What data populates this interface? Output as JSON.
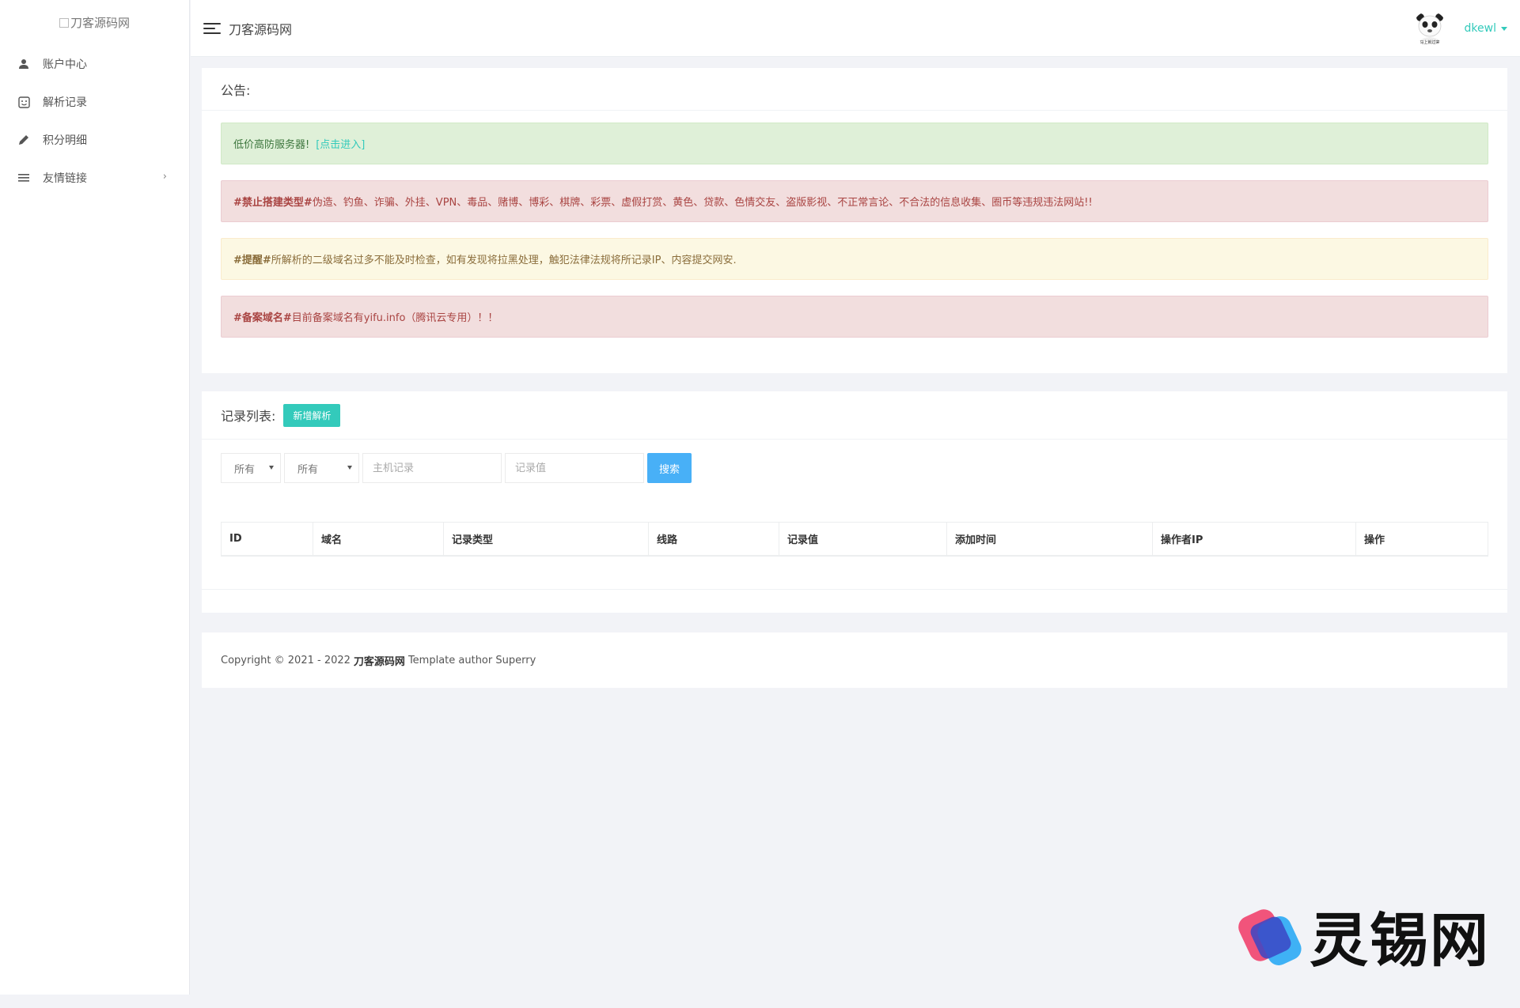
{
  "sidebar": {
    "logo_alt": "刀客源码网",
    "items": [
      {
        "label": "账户中心",
        "icon": "user-icon"
      },
      {
        "label": "解析记录",
        "icon": "sticker-icon"
      },
      {
        "label": "积分明细",
        "icon": "pencil-icon"
      },
      {
        "label": "友情链接",
        "icon": "list-icon",
        "chevron": "›"
      }
    ]
  },
  "header": {
    "site_title": "刀客源码网",
    "username": "dkewl",
    "avatar_caption": "马上就过来"
  },
  "notice": {
    "title": "公告:",
    "alerts": [
      {
        "type": "success",
        "text": "低价高防服务器!",
        "link": "[点击进入]"
      },
      {
        "type": "danger",
        "bold": "#禁止搭建类型#",
        "text": " 伪造、钓鱼、诈骗、外挂、VPN、毒品、赌博、博彩、棋牌、彩票、虚假打赏、黄色、贷款、色情交友、盗版影视、不正常言论、不合法的信息收集、圈币等违规违法网站!!"
      },
      {
        "type": "warning",
        "bold": "#提醒#",
        "text": " 所解析的二级域名过多不能及时检查，如有发现将拉黑处理，触犯法律法规将所记录IP、内容提交网安."
      },
      {
        "type": "danger",
        "bold": "#备案域名#",
        "text": " 目前备案域名有yifu.info（腾讯云专用）！！"
      }
    ]
  },
  "records": {
    "title": "记录列表:",
    "add_button": "新增解析",
    "filter_1": "所有",
    "filter_2": "所有",
    "host_placeholder": "主机记录",
    "value_placeholder": "记录值",
    "search_button": "搜索",
    "columns": [
      "ID",
      "域名",
      "记录类型",
      "线路",
      "记录值",
      "添加时间",
      "操作者IP",
      "操作"
    ]
  },
  "footer": {
    "prefix": "Copyright © 2021 - 2022",
    "brand": "刀客源码网",
    "suffix": "Template author Superry"
  },
  "watermark": {
    "text": "灵锡网"
  },
  "colors": {
    "accent": "#33cabb",
    "search": "#48b0f7",
    "background": "#f2f3f7"
  }
}
